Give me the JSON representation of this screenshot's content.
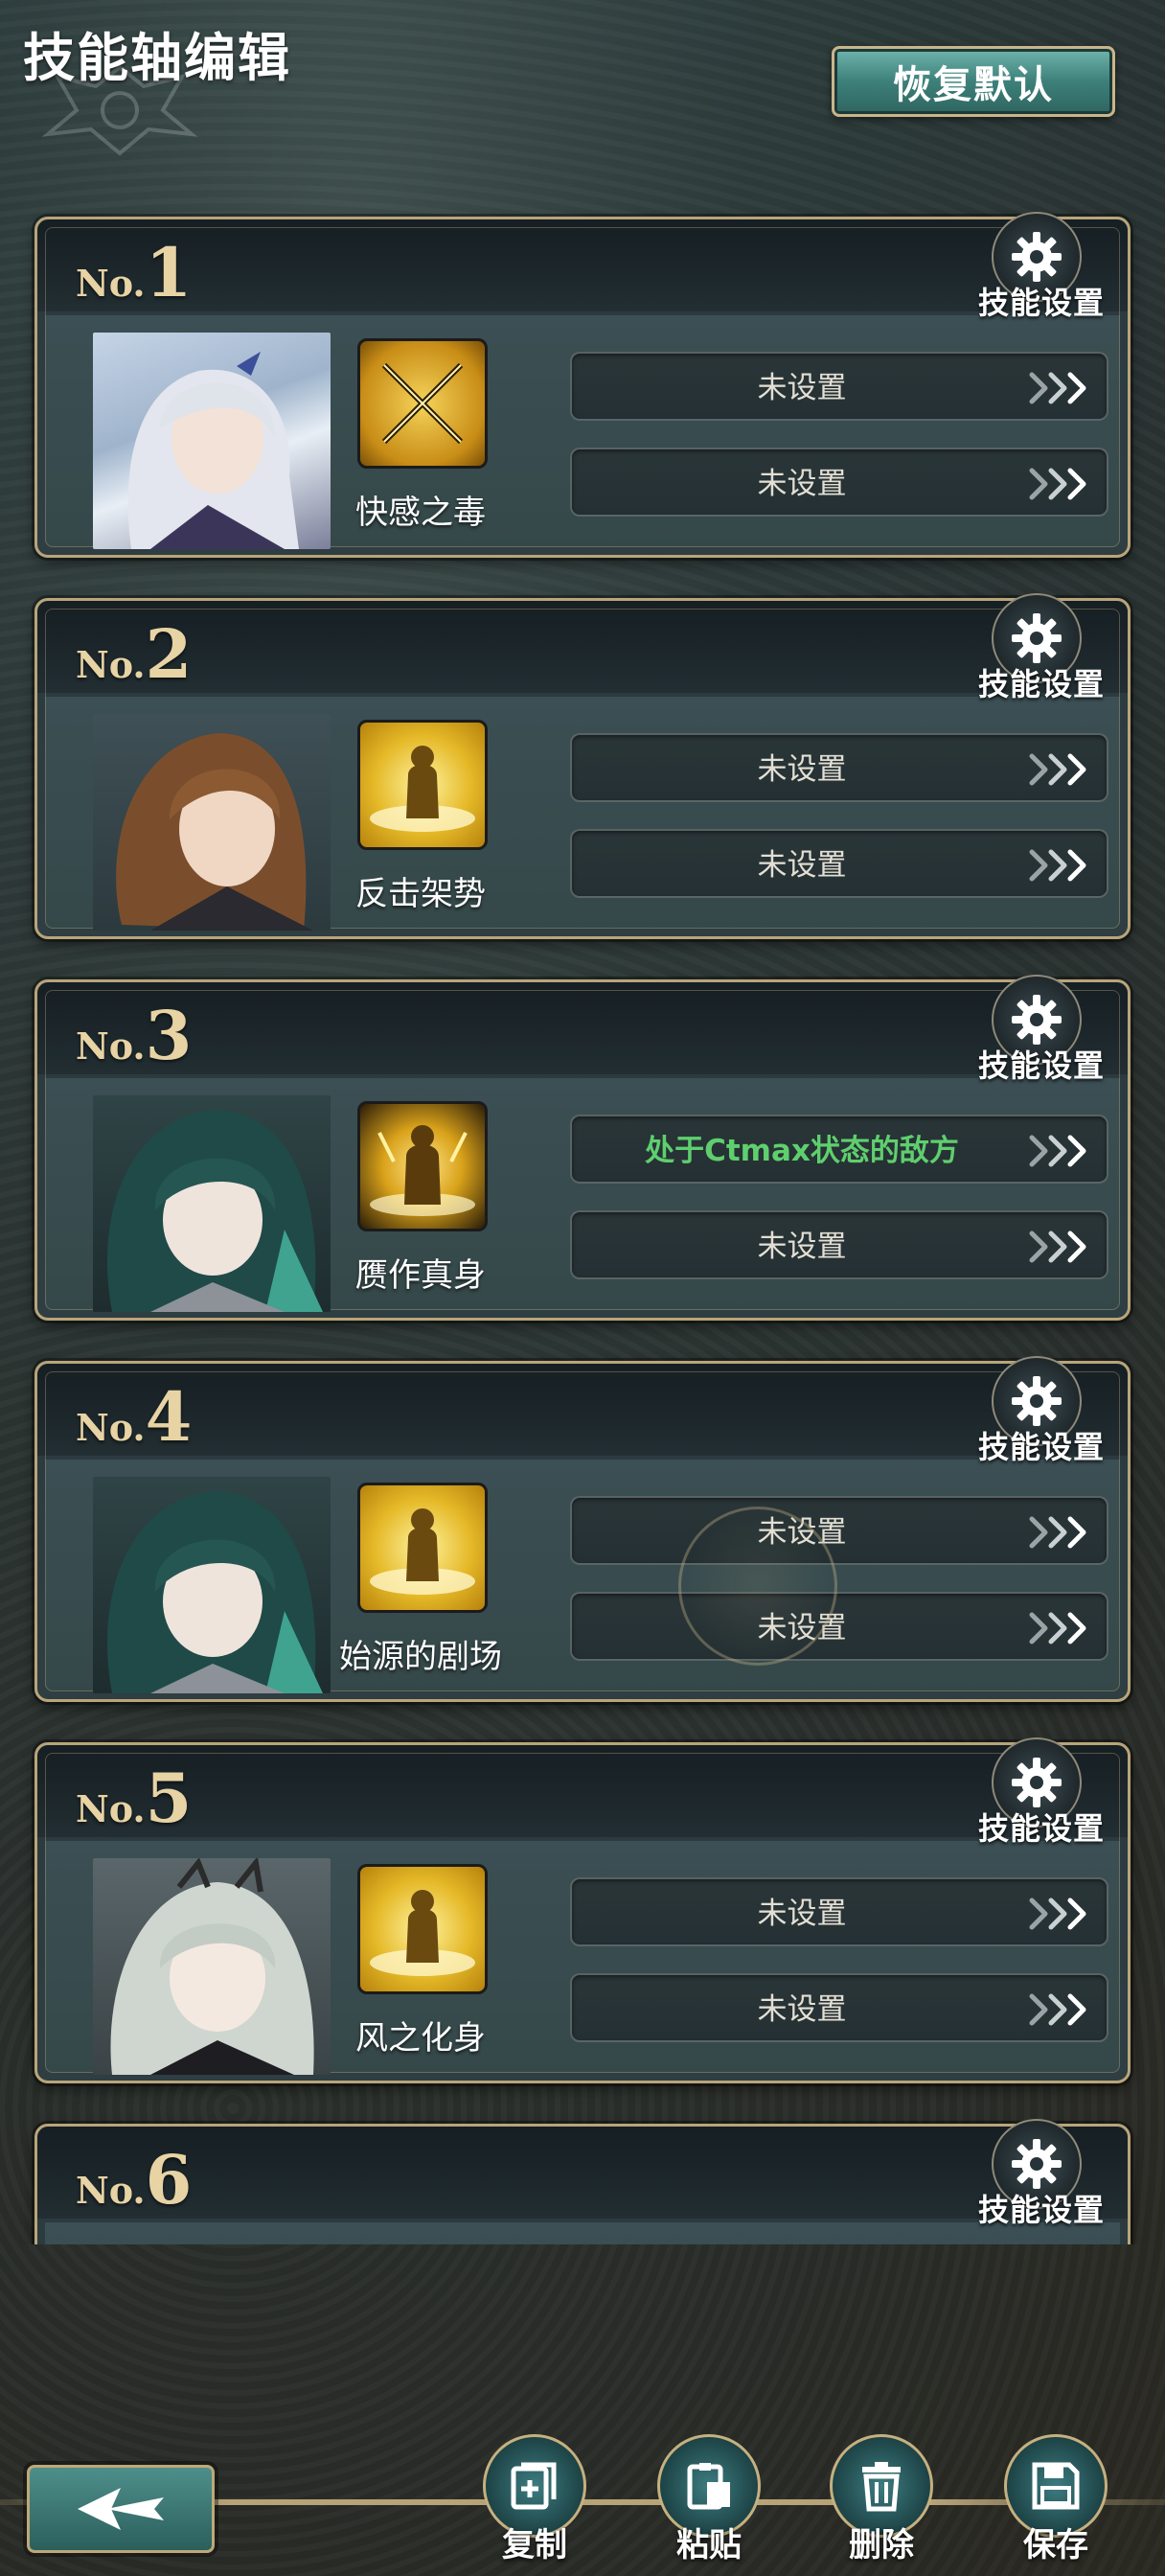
{
  "header": {
    "title": "技能轴编辑",
    "restore_label": "恢复默认"
  },
  "cards": [
    {
      "num_prefix": "No.",
      "num": "1",
      "gear_label": "技能设置",
      "skill_name": "快感之毒",
      "slot1": "未设置",
      "slot2": "未设置"
    },
    {
      "num_prefix": "No.",
      "num": "2",
      "gear_label": "技能设置",
      "skill_name": "反击架势",
      "slot1": "未设置",
      "slot2": "未设置"
    },
    {
      "num_prefix": "No.",
      "num": "3",
      "gear_label": "技能设置",
      "skill_name": "赝作真身",
      "slot1": "处于Ctmax状态的敌方",
      "slot2": "未设置"
    },
    {
      "num_prefix": "No.",
      "num": "4",
      "gear_label": "技能设置",
      "skill_name": "始源的剧场",
      "slot1": "未设置",
      "slot2": "未设置"
    },
    {
      "num_prefix": "No.",
      "num": "5",
      "gear_label": "技能设置",
      "skill_name": "风之化身",
      "slot1": "未设置",
      "slot2": "未设置"
    },
    {
      "num_prefix": "No.",
      "num": "6",
      "gear_label": "技能设置"
    }
  ],
  "bottom": {
    "copy_label": "复制",
    "paste_label": "粘贴",
    "delete_label": "删除",
    "save_label": "保存"
  },
  "colors": {
    "accent_gold": "#c9b58a",
    "teal_button": "#3d807a",
    "slot_active_text": "#5fcf6e"
  },
  "icons": [
    "gear-icon",
    "triple-chevron-icon",
    "back-arrow-icon",
    "copy-icon",
    "paste-icon",
    "trash-icon",
    "save-icon"
  ]
}
